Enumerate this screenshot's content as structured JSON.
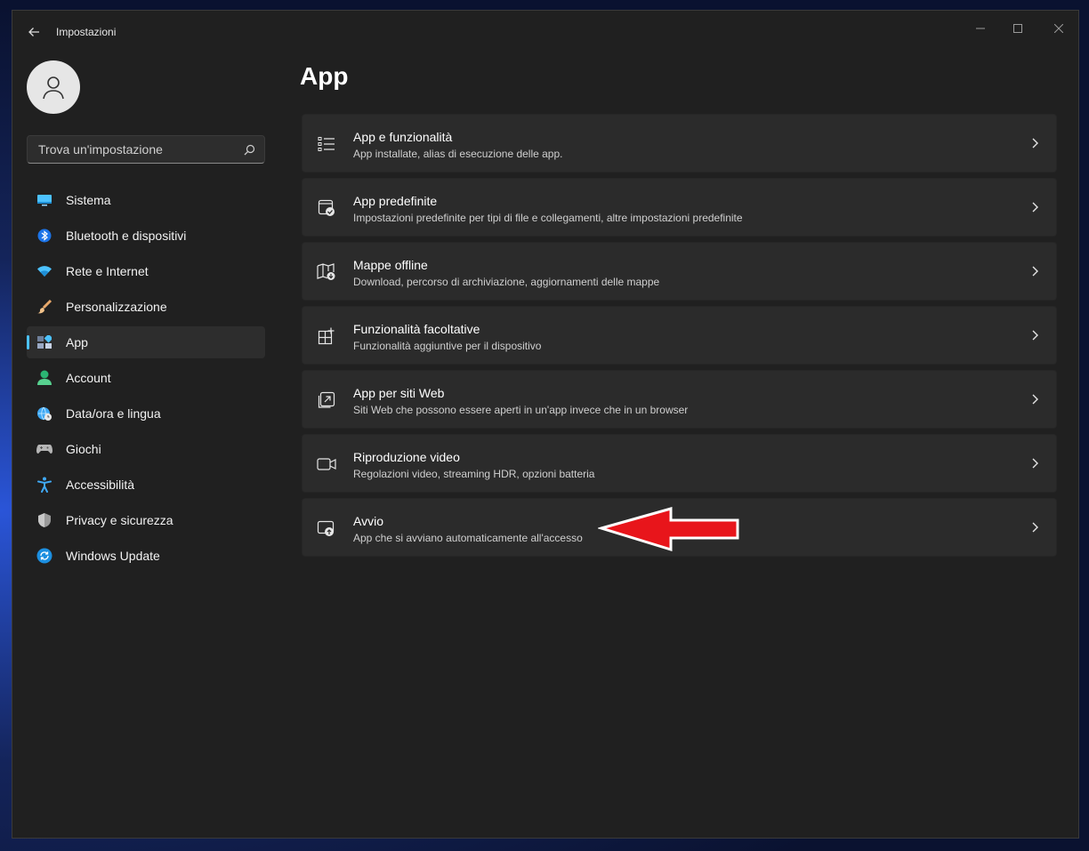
{
  "window": {
    "title": "Impostazioni"
  },
  "search": {
    "placeholder": "Trova un'impostazione"
  },
  "sidebar": {
    "items": [
      {
        "label": "Sistema",
        "icon": "monitor-icon",
        "active": false
      },
      {
        "label": "Bluetooth e dispositivi",
        "icon": "bluetooth-icon",
        "active": false
      },
      {
        "label": "Rete e Internet",
        "icon": "wifi-icon",
        "active": false
      },
      {
        "label": "Personalizzazione",
        "icon": "paintbrush-icon",
        "active": false
      },
      {
        "label": "App",
        "icon": "apps-icon",
        "active": true
      },
      {
        "label": "Account",
        "icon": "person-icon",
        "active": false
      },
      {
        "label": "Data/ora e lingua",
        "icon": "globe-clock-icon",
        "active": false
      },
      {
        "label": "Giochi",
        "icon": "gamepad-icon",
        "active": false
      },
      {
        "label": "Accessibilità",
        "icon": "accessibility-icon",
        "active": false
      },
      {
        "label": "Privacy e sicurezza",
        "icon": "shield-icon",
        "active": false
      },
      {
        "label": "Windows Update",
        "icon": "update-icon",
        "active": false
      }
    ]
  },
  "main": {
    "title": "App",
    "cards": [
      {
        "title": "App e funzionalità",
        "subtitle": "App installate, alias di esecuzione delle app.",
        "icon": "app-list-icon"
      },
      {
        "title": "App predefinite",
        "subtitle": "Impostazioni predefinite per tipi di file e collegamenti, altre impostazioni predefinite",
        "icon": "default-apps-icon"
      },
      {
        "title": "Mappe offline",
        "subtitle": "Download, percorso di archiviazione, aggiornamenti delle mappe",
        "icon": "offline-map-icon"
      },
      {
        "title": "Funzionalità facoltative",
        "subtitle": "Funzionalità aggiuntive per il dispositivo",
        "icon": "optional-features-icon"
      },
      {
        "title": "App per siti Web",
        "subtitle": "Siti Web che possono essere aperti in un'app invece che in un browser",
        "icon": "website-apps-icon"
      },
      {
        "title": "Riproduzione video",
        "subtitle": "Regolazioni video, streaming HDR, opzioni batteria",
        "icon": "video-camera-icon"
      },
      {
        "title": "Avvio",
        "subtitle": "App che si avviano automaticamente all'accesso",
        "icon": "startup-icon"
      }
    ]
  },
  "colors": {
    "accent": "#4cc2ff",
    "annotation_arrow": "#e8151b"
  }
}
